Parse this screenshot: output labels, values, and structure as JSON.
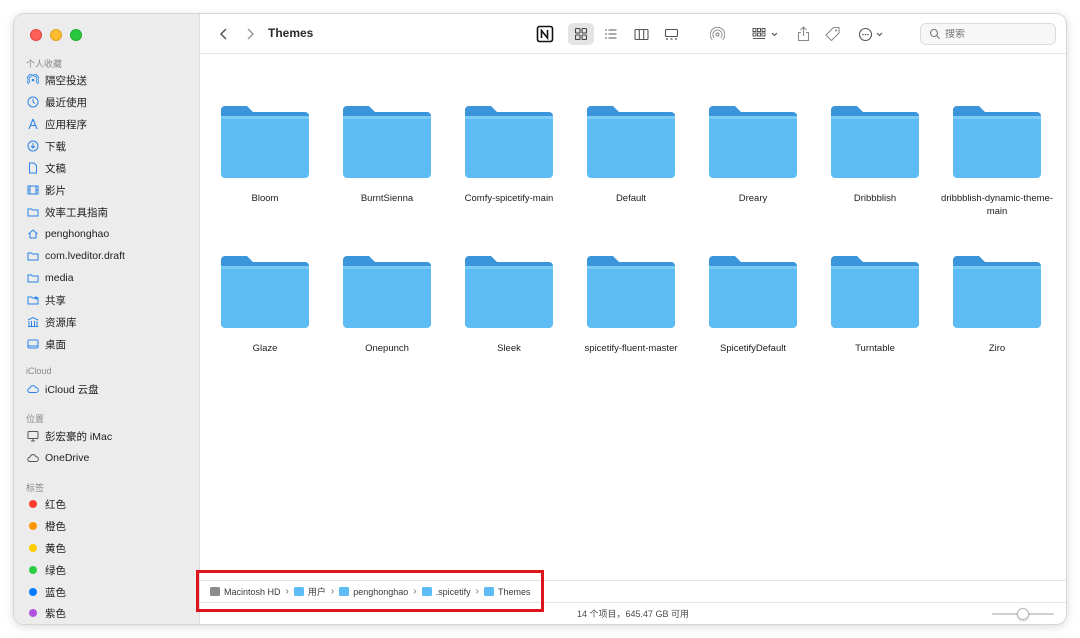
{
  "window": {
    "title": "Themes"
  },
  "sidebar": {
    "sections": [
      {
        "key": "favorites",
        "label": "个人收藏"
      },
      {
        "key": "icloud",
        "label": "iCloud"
      },
      {
        "key": "locations",
        "label": "位置"
      },
      {
        "key": "tags",
        "label": "标签"
      }
    ],
    "favorites": [
      {
        "label": "隔空投送",
        "icon": "airdrop-icon"
      },
      {
        "label": "最近使用",
        "icon": "clock-icon"
      },
      {
        "label": "应用程序",
        "icon": "applications-icon"
      },
      {
        "label": "下载",
        "icon": "download-icon"
      },
      {
        "label": "文稿",
        "icon": "document-icon"
      },
      {
        "label": "影片",
        "icon": "film-icon"
      },
      {
        "label": "效率工具指南",
        "icon": "folder-icon"
      },
      {
        "label": "penghonghao",
        "icon": "home-icon"
      },
      {
        "label": "com.lveditor.draft",
        "icon": "folder-icon"
      },
      {
        "label": "media",
        "icon": "folder-icon"
      },
      {
        "label": "共享",
        "icon": "shared-folder-icon"
      },
      {
        "label": "资源库",
        "icon": "library-icon"
      },
      {
        "label": "桌面",
        "icon": "desktop-icon"
      }
    ],
    "icloud": [
      {
        "label": "iCloud 云盘",
        "icon": "cloud-icon"
      }
    ],
    "locations": [
      {
        "label": "彭宏豪的 iMac",
        "icon": "computer-icon"
      },
      {
        "label": "OneDrive",
        "icon": "cloud-icon"
      }
    ],
    "tags": [
      {
        "label": "红色",
        "color": "#fe3b30"
      },
      {
        "label": "橙色",
        "color": "#fe9500"
      },
      {
        "label": "黄色",
        "color": "#ffcc00"
      },
      {
        "label": "绿色",
        "color": "#28cd41"
      },
      {
        "label": "蓝色",
        "color": "#007aff"
      },
      {
        "label": "紫色",
        "color": "#af52de"
      }
    ]
  },
  "toolbar": {
    "search_placeholder": "搜索"
  },
  "items": [
    {
      "name": "Bloom"
    },
    {
      "name": "BurntSienna"
    },
    {
      "name": "Comfy-spicetify-main"
    },
    {
      "name": "Default"
    },
    {
      "name": "Dreary"
    },
    {
      "name": "Dribbblish"
    },
    {
      "name": "dribbblish-dynamic-theme-main"
    },
    {
      "name": "Glaze"
    },
    {
      "name": "Onepunch"
    },
    {
      "name": "Sleek"
    },
    {
      "name": "spicetify-fluent-master"
    },
    {
      "name": "SpicetifyDefault"
    },
    {
      "name": "Turntable"
    },
    {
      "name": "Ziro"
    }
  ],
  "pathbar": [
    {
      "label": "Macintosh HD",
      "icon": "hard-drive-icon"
    },
    {
      "label": "用户",
      "icon": "folder-icon"
    },
    {
      "label": "penghonghao",
      "icon": "folder-icon"
    },
    {
      "label": ".spicetify",
      "icon": "folder-icon"
    },
    {
      "label": "Themes",
      "icon": "folder-icon"
    }
  ],
  "status": {
    "text": "14 个项目，645.47 GB 可用",
    "zoom_level": 0.5
  },
  "colors": {
    "folder_body": "#5ebcf4",
    "folder_tab": "#3a95db",
    "highlight_border": "#e0151b"
  }
}
